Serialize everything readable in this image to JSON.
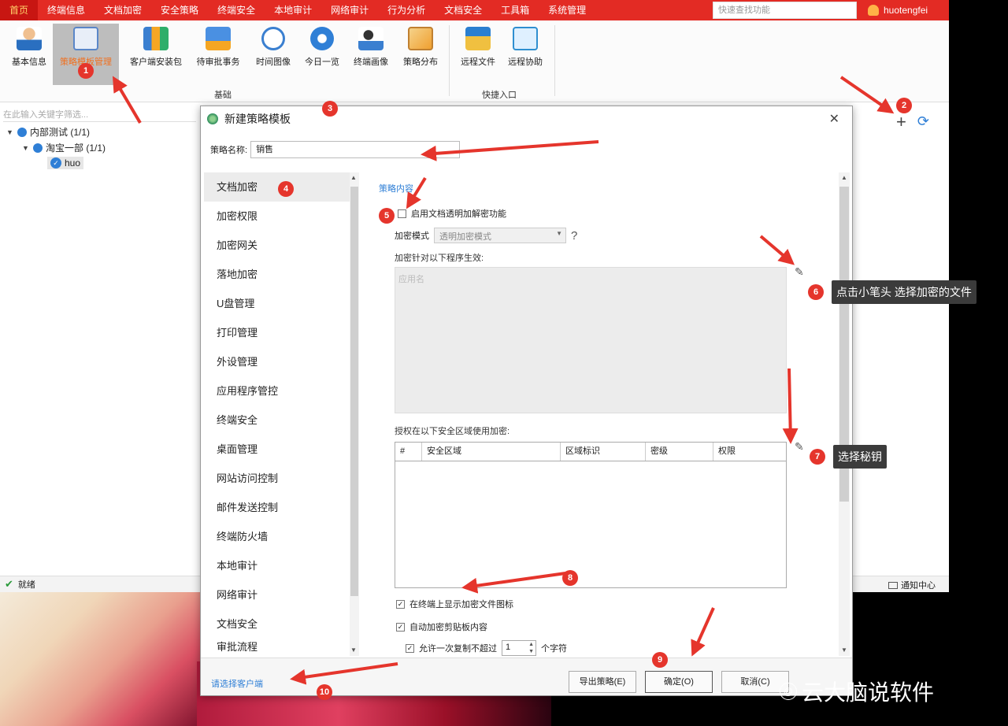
{
  "menubar": {
    "items": [
      "首页",
      "终端信息",
      "文档加密",
      "安全策略",
      "终端安全",
      "本地审计",
      "网络审计",
      "行为分析",
      "文档安全",
      "工具箱",
      "系统管理"
    ],
    "quick_search_placeholder": "快速查找功能",
    "username": "huotengfei"
  },
  "ribbon": {
    "buttons": [
      "基本信息",
      "策略模板管理",
      "客户端安装包",
      "待审批事务",
      "时间图像",
      "今日一览",
      "终端画像",
      "策略分布",
      "远程文件",
      "远程协助"
    ],
    "group_basic": "基础",
    "group_quick": "快捷入口"
  },
  "tree": {
    "search_placeholder": "在此输入关键字筛选...",
    "root": "内部测试 (1/1)",
    "child": "淘宝一部 (1/1)",
    "leaf": "huo"
  },
  "statusbar": {
    "status": "就绪",
    "notify": "通知中心"
  },
  "dialog": {
    "title": "新建策略模板",
    "name_label": "策略名称:",
    "name_value": "销售",
    "nav_items": [
      "文档加密",
      "加密权限",
      "加密网关",
      "落地加密",
      "U盘管理",
      "打印管理",
      "外设管理",
      "应用程序管控",
      "终端安全",
      "桌面管理",
      "网站访问控制",
      "邮件发送控制",
      "终端防火墙",
      "本地审计",
      "网络审计",
      "文档安全",
      "审批流程"
    ],
    "content": {
      "section_title": "策略内容",
      "enable_label": "启用文档透明加解密功能",
      "mode_label": "加密模式",
      "mode_value": "透明加密模式",
      "help": "?",
      "programs_label": "加密针对以下程序生效:",
      "programs_placeholder": "应用名",
      "areas_label": "授权在以下安全区域使用加密:",
      "area_columns": [
        "#",
        "安全区域",
        "区域标识",
        "密级",
        "权限"
      ],
      "show_icon_label": "在终端上显示加密文件图标",
      "auto_clipboard_label": "自动加密剪贴板内容",
      "allow_copy_label": "允许一次复制不超过",
      "copy_count": "1",
      "chars_unit": "个字符"
    },
    "footer": {
      "choose_client": "请选择客户端",
      "export": "导出策略(E)",
      "ok": "确定(O)",
      "cancel": "取消(C)"
    }
  },
  "annotations": {
    "badges": [
      "1",
      "2",
      "3",
      "4",
      "5",
      "6",
      "7",
      "8",
      "9",
      "10"
    ],
    "callout_pencil": "点击小笔头 选择加密的文件",
    "callout_key": "选择秘钥"
  },
  "watermark": "云大脑说软件",
  "colors": {
    "menubar_red": "#e32b24",
    "accent_blue": "#2f7fd6",
    "annotation_red": "#e5352c"
  }
}
